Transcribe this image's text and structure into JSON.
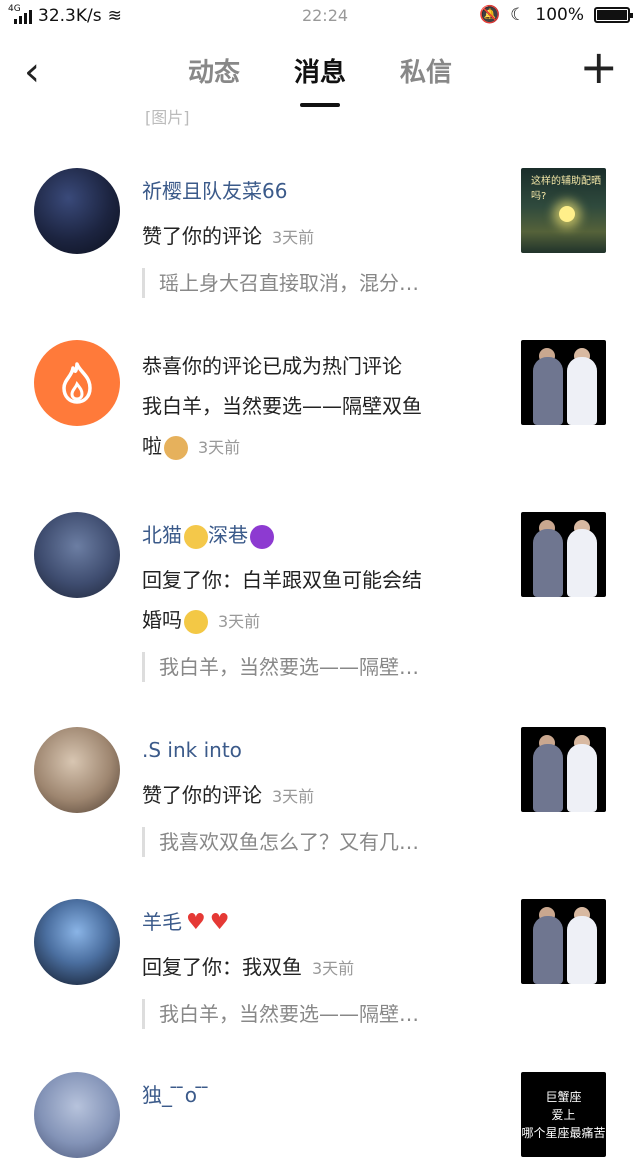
{
  "status_bar": {
    "network": "4G",
    "speed": "32.3K/s",
    "time": "22:24",
    "battery": "100%",
    "battery_level": 1.0
  },
  "header": {
    "tabs": [
      {
        "label": "动态"
      },
      {
        "label": "消息"
      },
      {
        "label": "私信"
      }
    ],
    "active_tab": "消息"
  },
  "partial_text": "[图片]",
  "items": [
    {
      "name": "祈樱且队友菜66",
      "action": "赞了你的评论",
      "time": "3天前",
      "quote": "瑶上身大召直接取消，混分…",
      "thumb_caption": "这样的辅助配晒吗?"
    },
    {
      "line1": "恭喜你的评论已成为热门评论",
      "line2": "我白羊，当然要选——隔壁双鱼",
      "line3": "啦",
      "time": "3天前"
    },
    {
      "name_part1": "北猫",
      "name_part2": "深巷",
      "action": "回复了你：白羊跟双鱼可能会结",
      "action2": "婚吗",
      "time": "3天前",
      "quote": "我白羊，当然要选——隔壁…"
    },
    {
      "name": ".S ink into",
      "action": "赞了你的评论",
      "time": "3天前",
      "quote": "我喜欢双鱼怎么了？又有几…"
    },
    {
      "name": "羊毛",
      "action": "回复了你：我双鱼",
      "time": "3天前",
      "quote": "我白羊，当然要选——隔壁…"
    },
    {
      "name": "独_ ̄ ̄o ̄ ̄",
      "thumb_lines": [
        "巨蟹座",
        "爱上",
        "哪个星座最痛苦"
      ]
    }
  ],
  "colors": {
    "name": "#3b5a8a",
    "hot_avatar": "#ff7a3a",
    "heart": "#e53935"
  }
}
